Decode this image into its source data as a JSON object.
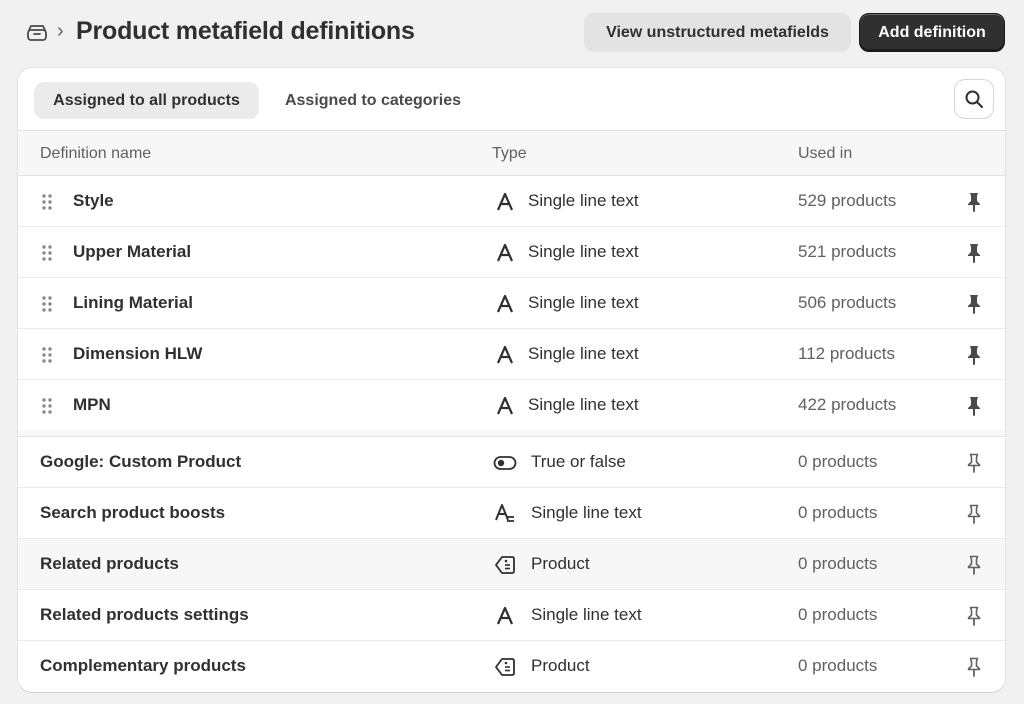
{
  "header": {
    "breadcrumb_icon": "store-icon",
    "separator": "›",
    "title": "Product metafield definitions",
    "secondary_button": "View unstructured metafields",
    "primary_button": "Add definition"
  },
  "tabs": [
    {
      "label": "Assigned to all products",
      "active": true
    },
    {
      "label": "Assigned to categories",
      "active": false
    }
  ],
  "search_icon": "search-icon",
  "columns": {
    "name": "Definition name",
    "type": "Type",
    "used_in": "Used in"
  },
  "pinned_rows": [
    {
      "name": "Style",
      "type": "Single line text",
      "type_icon": "text-icon",
      "used_in": "529 products",
      "pinned": true
    },
    {
      "name": "Upper Material",
      "type": "Single line text",
      "type_icon": "text-icon",
      "used_in": "521 products",
      "pinned": true
    },
    {
      "name": "Lining Material",
      "type": "Single line text",
      "type_icon": "text-icon",
      "used_in": "506 products",
      "pinned": true
    },
    {
      "name": "Dimension HLW",
      "type": "Single line text",
      "type_icon": "text-icon",
      "used_in": "112 products",
      "pinned": true
    },
    {
      "name": "MPN",
      "type": "Single line text",
      "type_icon": "text-icon",
      "used_in": "422 products",
      "pinned": true
    }
  ],
  "unpinned_rows": [
    {
      "name": "Google: Custom Product",
      "type": "True or false",
      "type_icon": "toggle-icon",
      "used_in": "0 products",
      "pinned": false
    },
    {
      "name": "Search product boosts",
      "type": "Single line text",
      "type_icon": "text-list-icon",
      "used_in": "0 products",
      "pinned": false
    },
    {
      "name": "Related products",
      "type": "Product",
      "type_icon": "product-tag-icon",
      "used_in": "0 products",
      "pinned": false
    },
    {
      "name": "Related products settings",
      "type": "Single line text",
      "type_icon": "text-icon",
      "used_in": "0 products",
      "pinned": false
    },
    {
      "name": "Complementary products",
      "type": "Product",
      "type_icon": "product-tag-icon",
      "used_in": "0 products",
      "pinned": false
    }
  ],
  "colors": {
    "background": "#f1f1f1",
    "card": "#ffffff",
    "primary_button": "#303030",
    "secondary_button": "#e3e3e3",
    "text": "#303030",
    "muted_text": "#616161"
  }
}
